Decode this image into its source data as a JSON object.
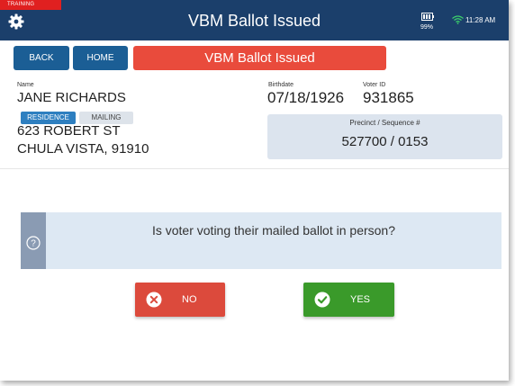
{
  "header": {
    "training_badge": "TRAINING",
    "title": "VBM Ballot Issued",
    "battery_percent": "99%",
    "time": "11:28 AM",
    "header_color": "#1b3f6b",
    "icons": [
      "gear-icon",
      "battery-icon",
      "wifi-icon"
    ]
  },
  "actions": {
    "back_label": "BACK",
    "home_label": "HOME",
    "status": "VBM Ballot Issued",
    "status_color": "#e94b3c"
  },
  "voter": {
    "name_label": "Name",
    "name": "JANE RICHARDS",
    "birthdate_label": "Birthdate",
    "birthdate": "07/18/1926",
    "voter_id_label": "Voter ID",
    "voter_id": "931865",
    "address_tabs": [
      "RESIDENCE",
      "MAILING"
    ],
    "address_line1": "623 ROBERT  ST",
    "address_line2": "CHULA VISTA, 91910",
    "precinct_label": "Precinct / Sequence #",
    "precinct_value": "527700 / 0153"
  },
  "question": {
    "text": "Is voter voting their mailed ballot in person?",
    "icon": "question-icon"
  },
  "answers": {
    "no_label": "NO",
    "yes_label": "YES",
    "no_color": "#dc4a3c",
    "yes_color": "#3a9a2a"
  }
}
